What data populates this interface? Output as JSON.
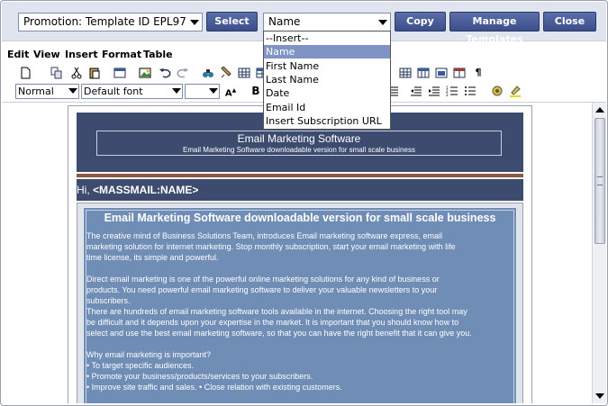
{
  "top_bar": {
    "promotion_select": "Promotion: Template ID EPL97",
    "select_button": "Select",
    "field_select": "Name",
    "copy_button": "Copy",
    "manage_button": "Manage Templates",
    "close_button": "Close"
  },
  "menu": [
    "Edit",
    "View",
    "Insert",
    "Format",
    "Table"
  ],
  "format_toolbar": {
    "paragraph_style": "Normal",
    "font": "Default font",
    "font_size": ""
  },
  "field_dropdown": {
    "options": [
      "--Insert--",
      "Name",
      "First Name",
      "Last Name",
      "Date",
      "Email Id",
      "Insert Subscription URL"
    ],
    "selected": "Name"
  },
  "email": {
    "header_title": "Email Marketing Software",
    "header_subtitle": "Email Marketing Software downloadable version for small scale business",
    "greeting_prefix": "Hi, ",
    "greeting_name": "<MASSMAIL:NAME>",
    "article_title": "Email Marketing Software downloadable version for small scale business",
    "article_lines": [
      "The creative mind of Business Solutions Team, introduces Email marketing software express, email",
      "marketing solution for internet marketing. Stop monthly subscription, start your email marketing with life",
      "time license, its simple and powerful.",
      "",
      "Direct email marketing is one of the powerful online marketing solutions for any kind of business or",
      "products. You need powerful email marketing software to deliver your valuable newsletters to your",
      "subscribers.",
      "There are hundreds of email marketing software tools available in the internet. Choosing the right tool may",
      "be difficult and it depends upon your expertise in the market. It is important that you should know how to",
      "select and use the best email marketing software, so that you can have the right benefit that it can give you.",
      "",
      "Why email marketing is important?",
      "• To target specific audiences.",
      "• Promote your business/products/services to your subscribers.",
      "• Improve site traffic and sales. • Close relation with existing customers."
    ]
  },
  "colors": {
    "button_bg": "#3b4e8a",
    "header_bg": "#3d4c6e",
    "content_bg": "#6f8db5",
    "selection": "#7f94c4"
  }
}
